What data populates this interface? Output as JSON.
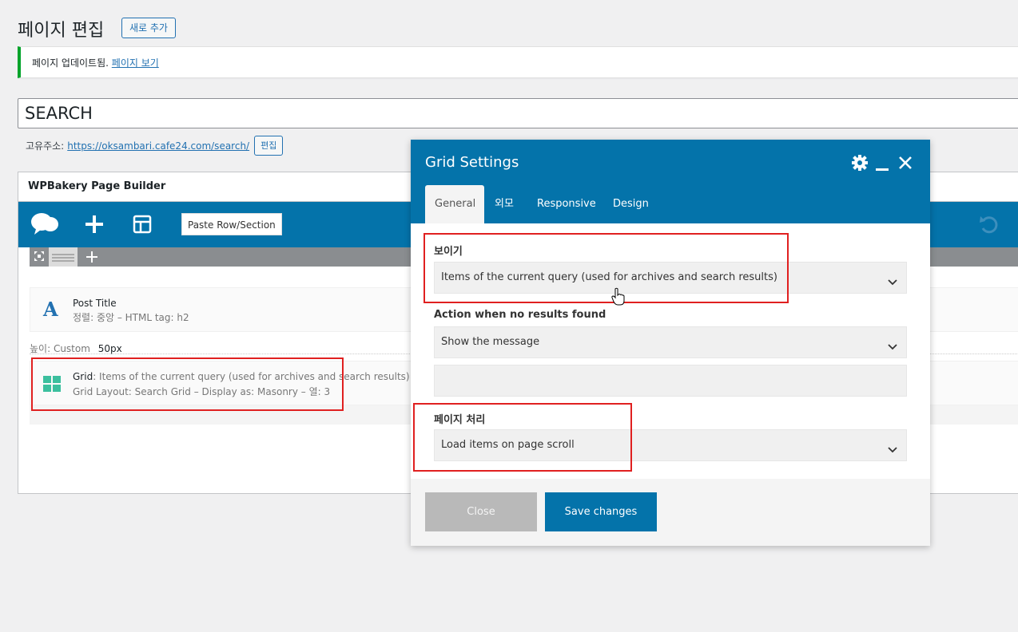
{
  "header": {
    "title": "페이지 편집",
    "add_new": "새로 추가"
  },
  "notice": {
    "text": "페이지 업데이트됨.",
    "link": "페이지 보기"
  },
  "post": {
    "title_value": "SEARCH"
  },
  "permalink": {
    "label": "고유주소:",
    "url": "https://oksambari.cafe24.com/search/",
    "edit": "편집"
  },
  "builder": {
    "title": "WPBakery Page Builder",
    "paste_label": "Paste Row/Section",
    "elements": {
      "post_title": {
        "name": "Post Title",
        "meta": "정렬: 중앙  – HTML tag: h2"
      },
      "spacer": {
        "label": "높이: Custom",
        "value": "50px"
      },
      "grid": {
        "name": "Grid",
        "desc": ": Items of the current query (used for archives and search results)",
        "meta": "Grid Layout: Search Grid – Display as: Masonry – 열: 3"
      }
    }
  },
  "modal": {
    "title": "Grid Settings",
    "tabs": [
      "General",
      "외모",
      "Responsive",
      "Design"
    ],
    "fields": {
      "visibility_label": "보이기",
      "visibility_value": "Items of the current query (used for archives and search results)",
      "no_results_label": "Action when no results found",
      "no_results_value": "Show the message",
      "pagination_label": "페이지 처리",
      "pagination_value": "Load items on page scroll"
    },
    "close_label": "Close",
    "save_label": "Save changes"
  },
  "colors": {
    "brand_blue": "#0473aa",
    "highlight_red": "#e02020",
    "notice_green": "#00a32a"
  }
}
